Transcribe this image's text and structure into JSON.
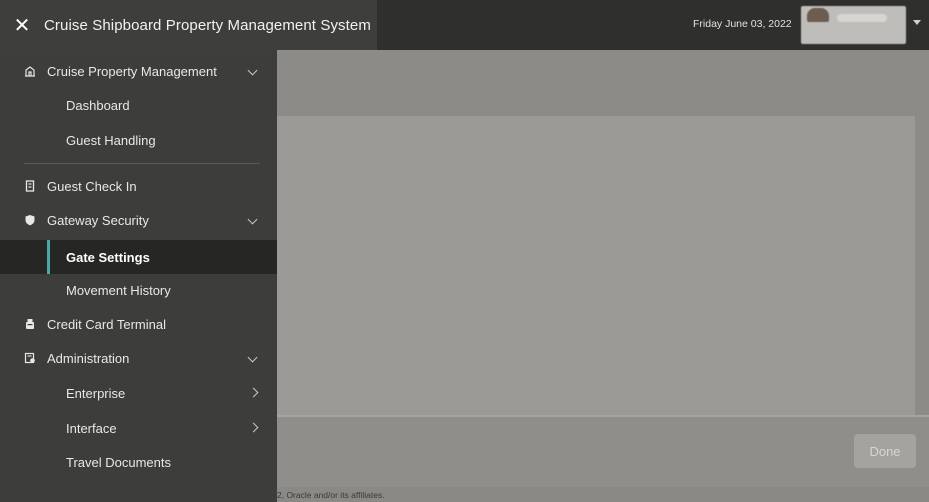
{
  "header": {
    "close_icon": "close-icon",
    "title": "Cruise Shipboard Property Management System",
    "date": "Friday June 03, 2022",
    "user_menu_icon": "caret-down-icon"
  },
  "sidebar": {
    "items": [
      {
        "label": "Cruise Property Management",
        "icon": "building-icon",
        "expanded": true
      },
      {
        "label": "Dashboard"
      },
      {
        "label": "Guest Handling"
      },
      {
        "label": "Guest Check In",
        "icon": "badge-icon"
      },
      {
        "label": "Gateway Security",
        "icon": "shield-icon",
        "expanded": true
      },
      {
        "label": "Gate Settings",
        "selected": true
      },
      {
        "label": "Movement History"
      },
      {
        "label": "Credit Card Terminal",
        "icon": "card-terminal-icon"
      },
      {
        "label": "Administration",
        "icon": "admin-icon",
        "expanded": true
      },
      {
        "label": "Enterprise",
        "has_submenu": true
      },
      {
        "label": "Interface",
        "has_submenu": true
      },
      {
        "label": "Travel Documents"
      }
    ]
  },
  "main": {
    "done_label": "Done",
    "footer_text": "2, Oracle and/or its affiliates."
  },
  "colors": {
    "header_bg": "#2f2f2e",
    "sidebar_bg": "#3d3d3b",
    "active_bg": "#262625",
    "active_accent": "#4aa8a8"
  }
}
